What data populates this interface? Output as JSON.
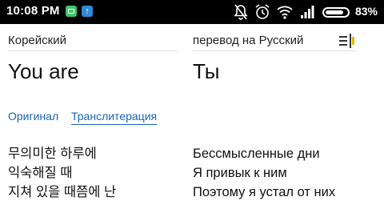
{
  "status_bar": {
    "time": "10:08 PM",
    "battery_percent_text": "83%",
    "battery_level": 0.83,
    "icons": [
      "app-icon",
      "upload-icon",
      "mute-icon",
      "alarm-icon",
      "wifi-icon",
      "signal-icon",
      "battery-icon"
    ]
  },
  "source": {
    "language": "Корейский",
    "word": "You are",
    "lines": [
      "무의미한 하루에",
      "익숙해질 때",
      "지쳐 있을 때쯤에 난"
    ]
  },
  "target": {
    "language": "перевод на Русский",
    "word": "Ты",
    "lines": [
      "Бессмысленные дни",
      "Я привык к ним",
      "Поэтому я устал от них"
    ]
  },
  "tabs": [
    "Оригинал",
    "Транслитерация"
  ],
  "colors": {
    "accent": "#1a64b8",
    "menu_icon": "#e6b400",
    "status_bg": "#000000"
  }
}
